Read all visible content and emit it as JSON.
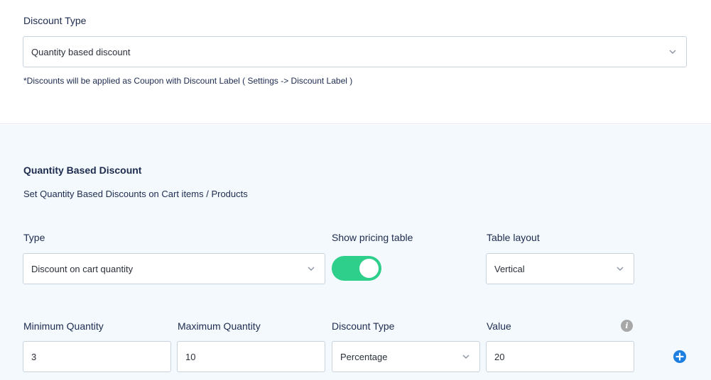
{
  "discount_type": {
    "label": "Discount Type",
    "selected": "Quantity based discount",
    "note": "*Discounts will be applied as Coupon with Discount Label ( Settings -> Discount Label )"
  },
  "quantity_section": {
    "title": "Quantity Based Discount",
    "subtitle": "Set Quantity Based Discounts on Cart items / Products"
  },
  "type": {
    "label": "Type",
    "selected": "Discount on cart quantity"
  },
  "pricing_table": {
    "label": "Show pricing table",
    "enabled": true
  },
  "table_layout": {
    "label": "Table layout",
    "selected": "Vertical"
  },
  "rule_row": {
    "min_label": "Minimum Quantity",
    "min_value": "3",
    "max_label": "Maximum Quantity",
    "max_value": "10",
    "discount_type_label": "Discount Type",
    "discount_type_selected": "Percentage",
    "value_label": "Value",
    "value": "20"
  },
  "icons": {
    "info": "info-icon",
    "add": "add-circle-icon",
    "chevron": "chevron-down-icon"
  },
  "colors": {
    "toggle_on": "#2ecf8a",
    "add_button": "#1d7fe0",
    "section_bg": "#f3f9fd"
  }
}
